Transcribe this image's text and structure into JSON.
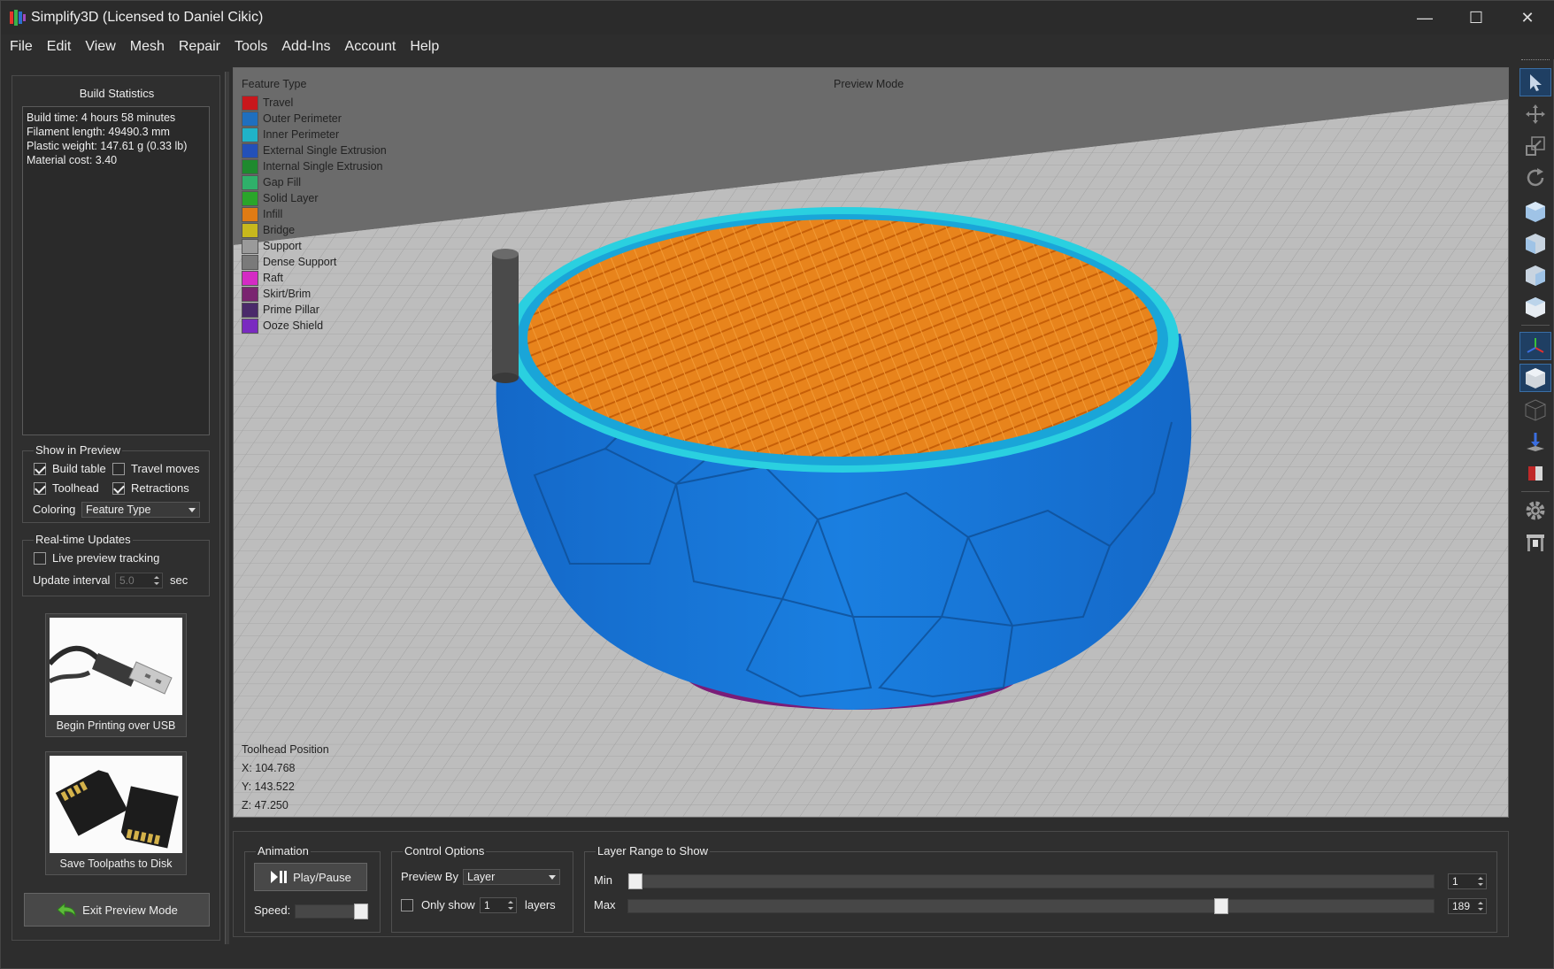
{
  "window": {
    "title": "Simplify3D (Licensed to Daniel Cikic)",
    "minimize_glyph": "—",
    "maximize_glyph": "☐",
    "close_glyph": "✕"
  },
  "menu": [
    "File",
    "Edit",
    "View",
    "Mesh",
    "Repair",
    "Tools",
    "Add-Ins",
    "Account",
    "Help"
  ],
  "build_stats": {
    "title": "Build Statistics",
    "lines": [
      "Build time: 4 hours 58 minutes",
      "Filament length: 49490.3 mm",
      "Plastic weight: 147.61 g (0.33 lb)",
      "Material cost: 3.40"
    ]
  },
  "show_in_preview": {
    "title": "Show in Preview",
    "build_table": {
      "label": "Build table",
      "checked": true
    },
    "travel_moves": {
      "label": "Travel moves",
      "checked": false
    },
    "toolhead": {
      "label": "Toolhead",
      "checked": true
    },
    "retractions": {
      "label": "Retractions",
      "checked": true
    },
    "coloring_label": "Coloring",
    "coloring_value": "Feature Type"
  },
  "realtime": {
    "title": "Real-time Updates",
    "live_tracking": {
      "label": "Live preview tracking",
      "checked": false
    },
    "interval_label": "Update interval",
    "interval_value": "5.0",
    "interval_unit": "sec"
  },
  "cards": {
    "usb_label": "Begin Printing over USB",
    "sd_label": "Save Toolpaths to Disk"
  },
  "exit_button": "Exit Preview Mode",
  "viewport": {
    "legend_title": "Feature Type",
    "mode_label": "Preview Mode",
    "legend": [
      {
        "label": "Travel",
        "color": "#c8171c"
      },
      {
        "label": "Outer Perimeter",
        "color": "#1f6fbf"
      },
      {
        "label": "Inner Perimeter",
        "color": "#1fb3c8"
      },
      {
        "label": "External Single Extrusion",
        "color": "#2350b8"
      },
      {
        "label": "Internal Single Extrusion",
        "color": "#1f8a2e"
      },
      {
        "label": "Gap Fill",
        "color": "#2fb06a"
      },
      {
        "label": "Solid Layer",
        "color": "#2aa52a"
      },
      {
        "label": "Infill",
        "color": "#e07b14"
      },
      {
        "label": "Bridge",
        "color": "#c8b81c"
      },
      {
        "label": "Support",
        "color": "#9a9a9a"
      },
      {
        "label": "Dense Support",
        "color": "#7a7a7a"
      },
      {
        "label": "Raft",
        "color": "#d42bc4"
      },
      {
        "label": "Skirt/Brim",
        "color": "#7a2470"
      },
      {
        "label": "Prime Pillar",
        "color": "#4a2a6a"
      },
      {
        "label": "Ooze Shield",
        "color": "#7a2ac0"
      }
    ],
    "toolhead": {
      "title": "Toolhead Position",
      "x": "X: 104.768",
      "y": "Y: 143.522",
      "z": "Z: 47.250"
    }
  },
  "animation": {
    "title": "Animation",
    "play_label": "Play/Pause",
    "speed_label": "Speed:",
    "speed_fraction": 1.0
  },
  "control": {
    "title": "Control Options",
    "preview_by_label": "Preview By",
    "preview_by_value": "Layer",
    "only_show_label": "Only show",
    "only_show_value": "1",
    "layers_label": "layers"
  },
  "layer_range": {
    "title": "Layer Range to Show",
    "min_label": "Min",
    "max_label": "Max",
    "min_value": "1",
    "max_value": "189",
    "min_fraction": 0.0,
    "max_fraction": 0.74
  },
  "right_toolbar": [
    "select-arrow-icon",
    "move-icon",
    "scale-icon",
    "rotate-icon",
    "view-iso-icon",
    "view-front-icon",
    "view-side-icon",
    "view-top-icon",
    "axes-icon",
    "solid-cube-icon",
    "wireframe-cube-icon",
    "cross-section-icon",
    "object-icon",
    "settings-gear-icon",
    "machine-icon"
  ]
}
